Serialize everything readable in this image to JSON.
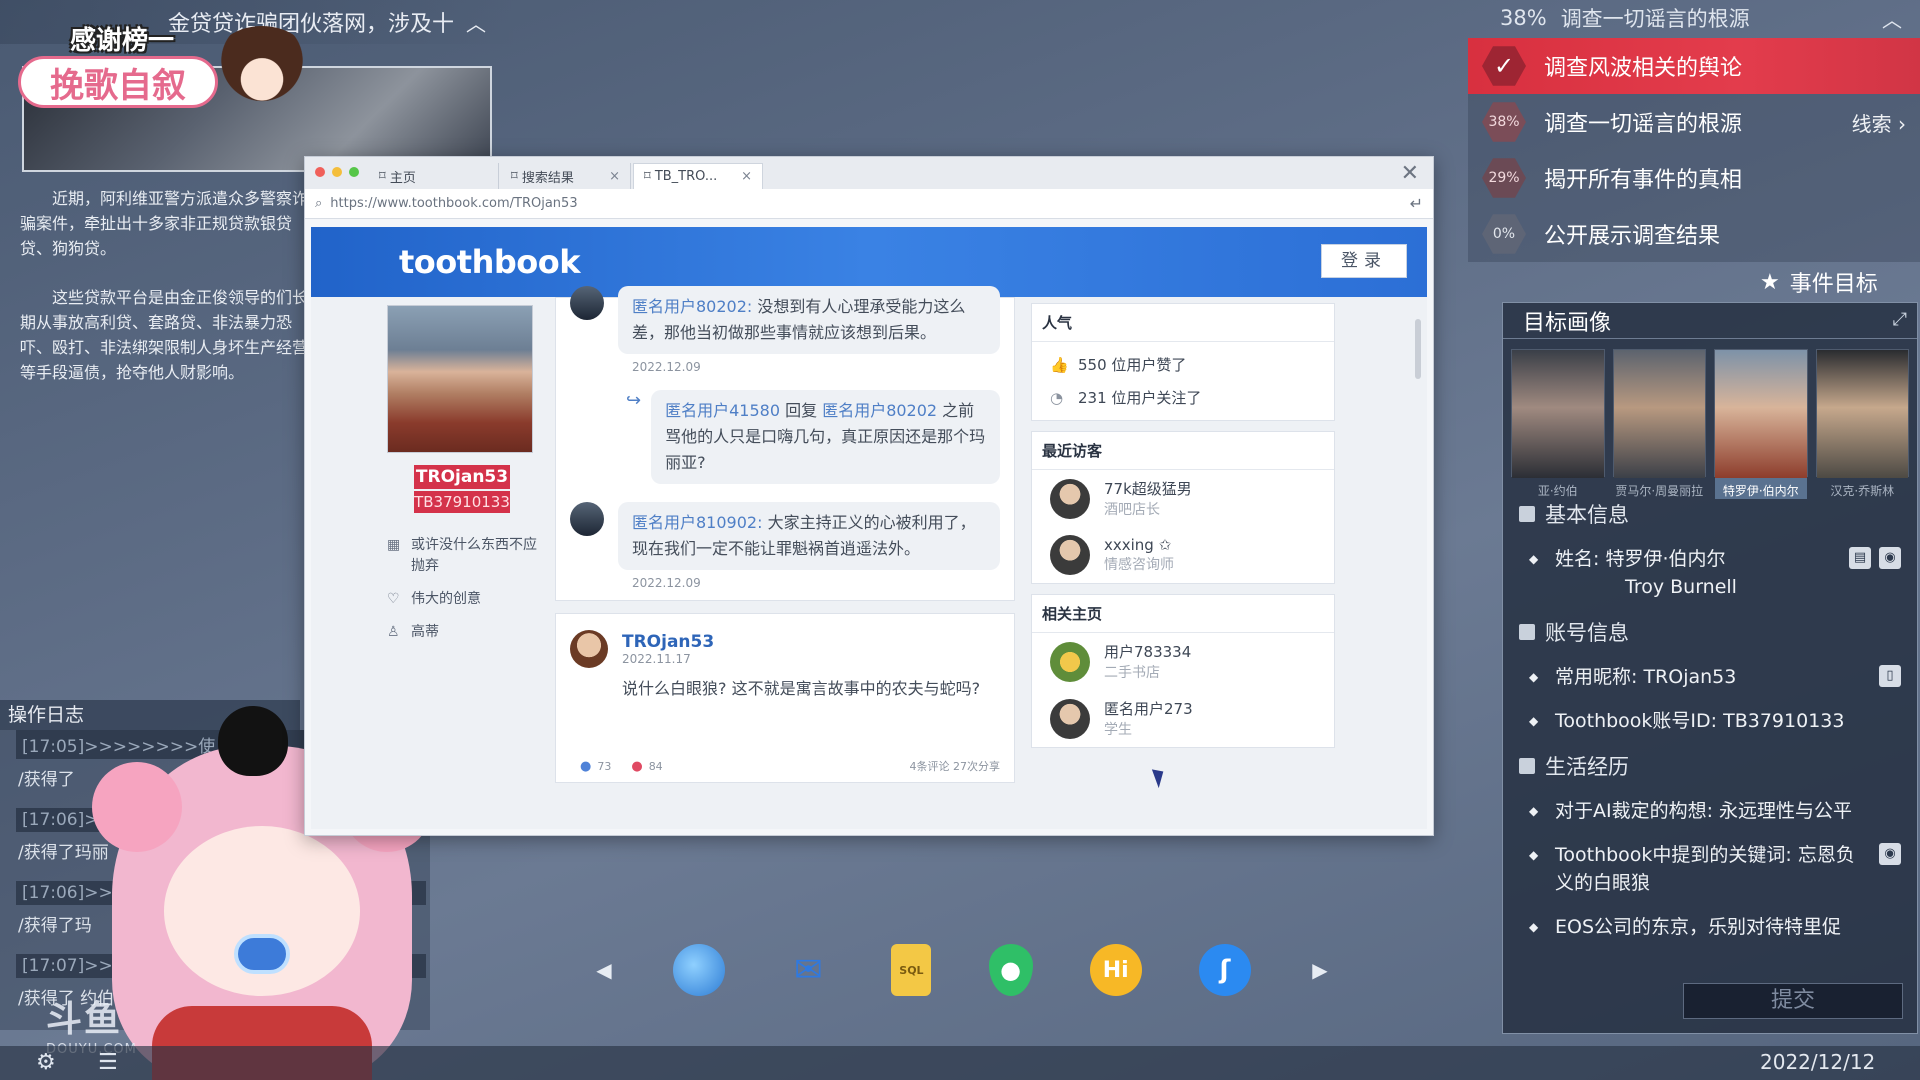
{
  "news": {
    "headline": "金贷贷诈骗团伙落网，涉及十",
    "paragraph1": "近期，阿利维亚警方派遣众多警察诈骗案件，牵扯出十多家非正规贷款银贷贷、狗狗贷。",
    "paragraph2": "这些贷款平台是由金正俊领导的们长期从事放高利贷、套路贷、非法暴力恐吓、殴打、非法绑架限制人身坏生产经营等手段逼债，抢夺他人财影响。"
  },
  "overlay": {
    "thanks_title": "感谢榜一",
    "thanks_name": "挽歌自叙",
    "watermark": "斗鱼",
    "watermark_sub": "DOUYU.COM"
  },
  "oplog": {
    "title": "操作日志",
    "rows": [
      {
        "time": "[17:05]>>>>>>>>使",
        "msg": "/获得了"
      },
      {
        "time": "[17:06]>>>",
        "msg": "/获得了玛丽"
      },
      {
        "time": "[17:06]>>>",
        "msg": "/获得了玛"
      },
      {
        "time": "[17:07]>>>",
        "msg": "/获得了 约伯的"
      }
    ]
  },
  "tasks": {
    "top_pct": "38%",
    "top_label": "调查一切谣言的根源",
    "items": [
      {
        "pct": "✓",
        "label": "调查风波相关的舆论",
        "state": "active"
      },
      {
        "pct": "38%",
        "label": "调查一切谣言的根源",
        "clue": "线索 ›"
      },
      {
        "pct": "29%",
        "label": "揭开所有事件的真相"
      },
      {
        "pct": "0%",
        "label": "公开展示调查结果"
      }
    ],
    "event_goal": "事件目标"
  },
  "target": {
    "title": "目标画像",
    "portraits": [
      {
        "name": "亚·约伯"
      },
      {
        "name": "贾马尔·周曼丽拉"
      },
      {
        "name": "特罗伊·伯内尔"
      },
      {
        "name": "汉克·乔斯林"
      }
    ],
    "basic_section": "基本信息",
    "name_label": "姓名:  特罗伊·伯内尔",
    "name_en": "Troy Burnell",
    "account_section": "账号信息",
    "nickname": "常用昵称: TROjan53",
    "account_id": "Toothbook账号ID: TB37910133",
    "life_section": "生活经历",
    "life1": "对于AI裁定的构想: 永远理性与公平",
    "life2": "Toothbook中提到的关键词: 忘恩负义的白眼狼",
    "life3": "EOS公司的东京，乐别对待特里促",
    "submit": "提交"
  },
  "date": "2022/12/12",
  "browser": {
    "tabs": [
      {
        "label": "主页"
      },
      {
        "label": "搜索结果"
      },
      {
        "label": "TB_TRO..."
      }
    ],
    "url": "https://www.toothbook.com/TROjan53"
  },
  "site": {
    "logo": "toothbook",
    "login": "登录",
    "profile": {
      "username": "TROjan53",
      "uid": "TB37910133",
      "bio1": "或许没什么东西不应抛弃",
      "bio2": "伟大的创意",
      "bio3": "高蒂"
    },
    "comment1": {
      "user": "匿名用户80202:",
      "text": " 没想到有人心理承受能力这么差，那他当初做那些事情就应该想到后果。",
      "date": "2022.12.09"
    },
    "reply1": {
      "user": "匿名用户41580",
      "verb": " 回复 ",
      "target": "匿名用户80202",
      "text": " 之前骂他的人只是口嗨几句，真正原因还是那个玛丽亚?"
    },
    "comment2": {
      "user": "匿名用户810902:",
      "text": " 大家主持正义的心被利用了，现在我们一定不能让罪魁祸首逍遥法外。",
      "date": "2022.12.09"
    },
    "post": {
      "author": "TROjan53",
      "date": "2022.11.17",
      "text": "说什么白眼狼? 这不就是寓言故事中的农夫与蛇吗?",
      "likes": "73",
      "hearts": "84",
      "meta": "4条评论  27次分享"
    },
    "popularity": {
      "title": "人气",
      "likes": "550  位用户赞了",
      "follows": "231  位用户关注了"
    },
    "visitors": {
      "title": "最近访客",
      "list": [
        {
          "name": "77k超级猛男",
          "sub": "酒吧店长"
        },
        {
          "name": "xxxing ✩",
          "sub": "情感咨询师"
        }
      ]
    },
    "related": {
      "title": "相关主页",
      "list": [
        {
          "name": "用户783334",
          "sub": "二手书店"
        },
        {
          "name": "匿名用户273",
          "sub": "学生"
        }
      ]
    }
  }
}
